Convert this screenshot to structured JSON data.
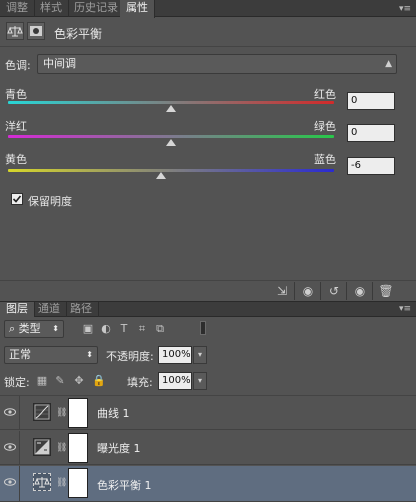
{
  "panel_tabs": {
    "adjust": "调整",
    "styles": "样式",
    "history": "历史记录",
    "properties": "属性"
  },
  "properties": {
    "title": "色彩平衡",
    "tone_label": "色调:",
    "tone_value": "中间调",
    "sliders": [
      {
        "left": "青色",
        "right": "红色",
        "value": "0",
        "position": 0.5
      },
      {
        "left": "洋红",
        "right": "绿色",
        "value": "0",
        "position": 0.5
      },
      {
        "left": "黄色",
        "right": "蓝色",
        "value": "-6",
        "position": 0.47
      }
    ],
    "preserve_luminosity": {
      "label": "保留明度",
      "checked": true
    }
  },
  "layers_tabs": {
    "layers": "图层",
    "channels": "通道",
    "paths": "路径"
  },
  "layers": {
    "filter_kind": "类型",
    "blend_mode": "正常",
    "opacity_label": "不透明度:",
    "opacity_value": "100%",
    "lock_label": "锁定:",
    "fill_label": "填充:",
    "fill_value": "100%",
    "items": [
      {
        "name": "曲线 1",
        "icon": "curves-icon",
        "selected": false
      },
      {
        "name": "曝光度 1",
        "icon": "exposure-icon",
        "selected": false
      },
      {
        "name": "色彩平衡 1",
        "icon": "color-balance-icon",
        "selected": true
      }
    ]
  },
  "colors": {
    "panel_bg": "#535353",
    "selected_row": "#5f6d80"
  }
}
